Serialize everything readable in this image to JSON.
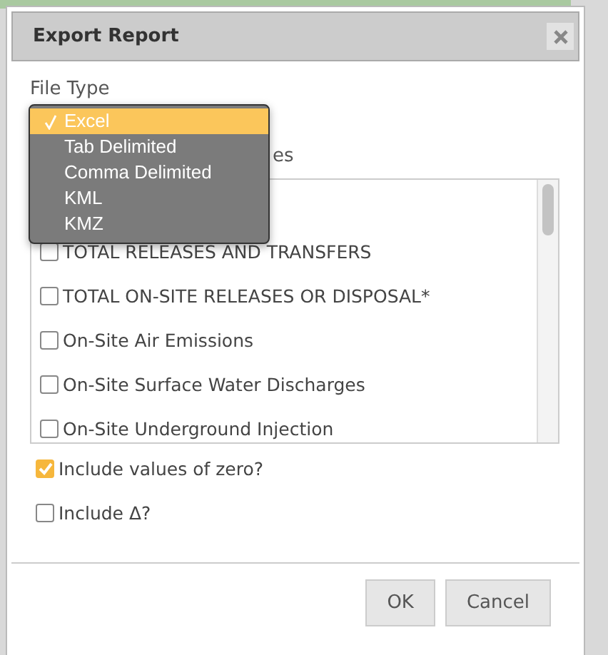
{
  "dialog": {
    "title": "Export Report",
    "file_type_label": "File Type",
    "file_type_options": [
      {
        "label": "Excel",
        "selected": true
      },
      {
        "label": "Tab Delimited",
        "selected": false
      },
      {
        "label": "Comma Delimited",
        "selected": false
      },
      {
        "label": "KML",
        "selected": false
      },
      {
        "label": "KMZ",
        "selected": false
      }
    ],
    "values_label": "es",
    "values": [
      {
        "label": "TOTAL RELEASES AND TRANSFERS",
        "checked": false
      },
      {
        "label": "TOTAL ON-SITE RELEASES OR DISPOSAL*",
        "checked": false
      },
      {
        "label": "On-Site Air Emissions",
        "checked": false
      },
      {
        "label": "On-Site Surface Water Discharges",
        "checked": false
      },
      {
        "label": "On-Site Underground Injection",
        "checked": false
      }
    ],
    "options": [
      {
        "label": "Include values of zero?",
        "checked": true
      },
      {
        "label": "Include Δ?",
        "checked": false
      }
    ],
    "buttons": [
      "OK",
      "Cancel"
    ]
  }
}
